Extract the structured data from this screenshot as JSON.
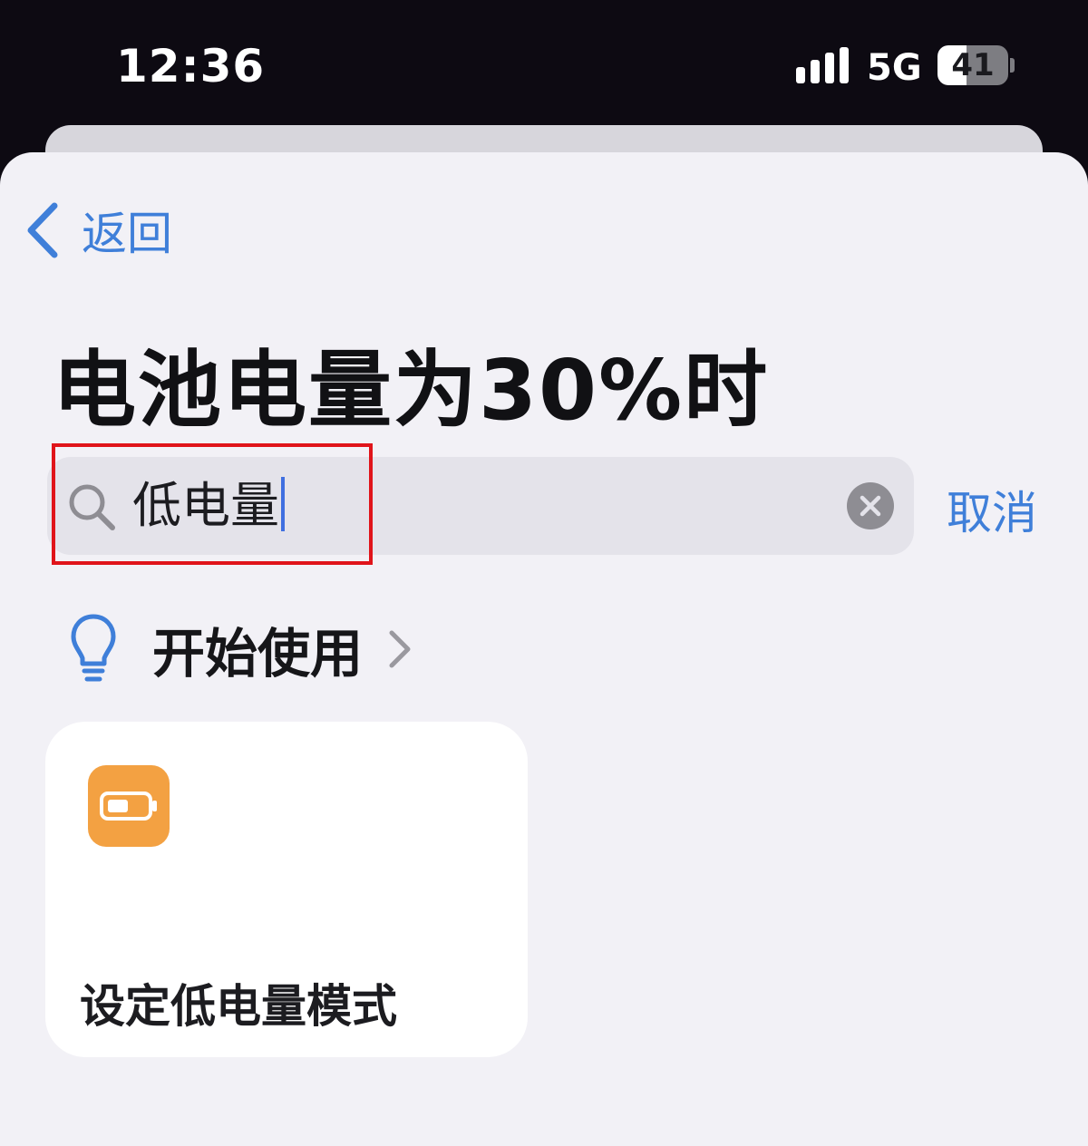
{
  "status_bar": {
    "time": "12:36",
    "network": "5G",
    "battery_level": "41"
  },
  "nav": {
    "back_label": "返回"
  },
  "page": {
    "title": "电池电量为30%时"
  },
  "search": {
    "value": "低电量",
    "cancel_label": "取消"
  },
  "get_started": {
    "label": "开始使用"
  },
  "results": [
    {
      "label": "设定低电量模式",
      "icon": "battery-icon",
      "icon_color": "#f3a142"
    }
  ],
  "colors": {
    "accent": "#3f7fd9",
    "highlight": "#e0141a",
    "sheet_background": "#f2f1f6"
  }
}
